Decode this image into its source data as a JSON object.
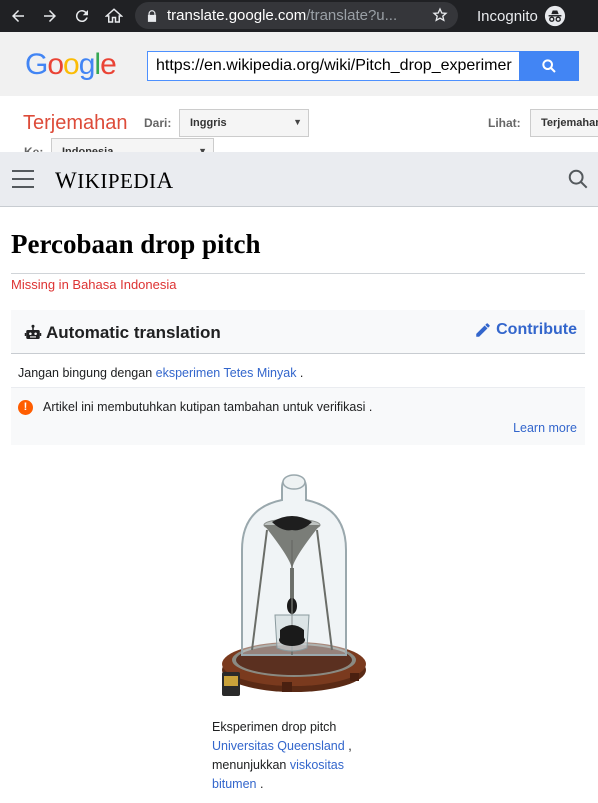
{
  "browser": {
    "url_main": "translate.google.com",
    "url_rest": "/translate?u...",
    "incognito_label": "Incognito"
  },
  "translate": {
    "logo": "Google",
    "url_value": "https://en.wikipedia.org/wiki/Pitch_drop_experimer",
    "title": "Terjemahan",
    "from_label": "Dari:",
    "from_value": "Inggris",
    "to_label": "Ke:",
    "to_value": "Indonesia",
    "view_label": "Lihat:",
    "view_value": "Terjemahan"
  },
  "wiki": {
    "wordmark": "Wikipedia",
    "page_title": "Percobaan drop pitch",
    "missing_note": "Missing in Bahasa Indonesia",
    "mt_title": "Automatic translation",
    "contribute": "Contribute",
    "hatnote_prefix": "Jangan bingung dengan ",
    "hatnote_link": "eksperimen Tetes Minyak",
    "hatnote_suffix": " .",
    "warning_text": "Artikel ini membutuhkan kutipan tambahan untuk verifikasi .",
    "learn_more": "Learn more",
    "caption_text1": "Eksperimen drop pitch",
    "caption_link1": "Universitas Queensland",
    "caption_text2": " ,",
    "caption_text3": "menunjukkan ",
    "caption_link2": "viskositas",
    "caption_link3": "bitumen",
    "caption_text4": " ."
  },
  "colors": {
    "chrome_bar": "#202124",
    "link": "#3366cc",
    "translate_title": "#dd4b39",
    "missing": "#dd3333"
  }
}
